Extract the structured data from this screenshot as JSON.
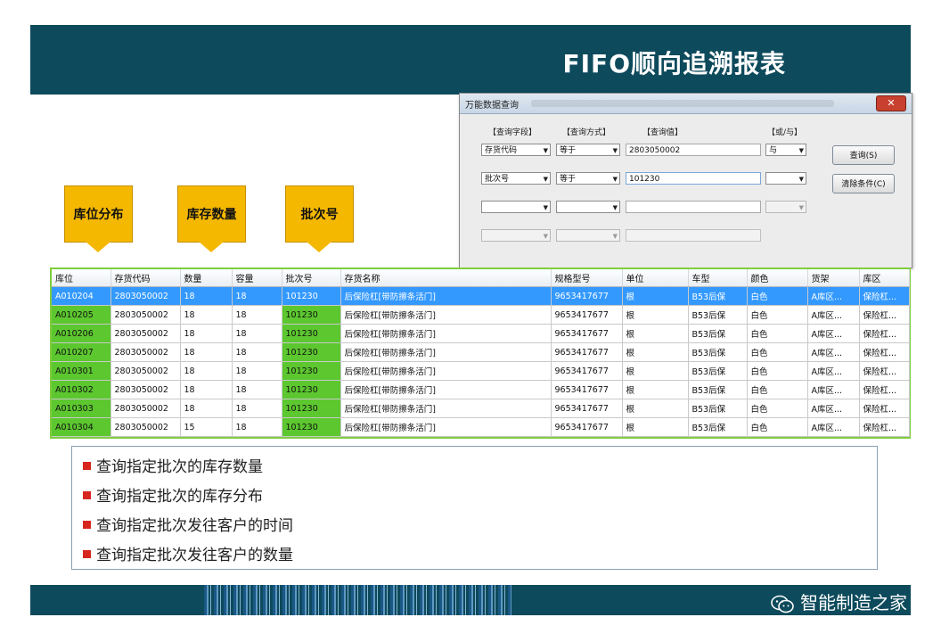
{
  "slide": {
    "title": "FIFO顺向追溯报表"
  },
  "dialog": {
    "title": "万能数据查询",
    "close_label": "✕",
    "headers": {
      "field": "【查询字段】",
      "method": "【查询方式】",
      "value": "【查询值】",
      "andor": "【或/与】"
    },
    "rows": [
      {
        "field": "存货代码",
        "method": "等于",
        "value": "2803050002",
        "andor": "与"
      },
      {
        "field": "批次号",
        "method": "等于",
        "value": "101230",
        "andor": ""
      },
      {
        "field": "",
        "method": "",
        "value": "",
        "andor": ""
      },
      {
        "field": "",
        "method": "",
        "value": "",
        "andor": ""
      }
    ],
    "query_button": "查询(S)",
    "clear_button": "清除条件(C)"
  },
  "callouts": [
    "库位分布",
    "库存数量",
    "批次号"
  ],
  "table": {
    "columns": [
      "库位",
      "存货代码",
      "数量",
      "容量",
      "批次号",
      "存货名称",
      "规格型号",
      "单位",
      "车型",
      "颜色",
      "货架",
      "库区"
    ],
    "rows": [
      [
        "A010204",
        "2803050002",
        "18",
        "18",
        "101230",
        "后保险杠[带防擦条活门]",
        "9653417677",
        "根",
        "B53后保",
        "白色",
        "A库区...",
        "保险杠..."
      ],
      [
        "A010205",
        "2803050002",
        "18",
        "18",
        "101230",
        "后保险杠[带防擦条活门]",
        "9653417677",
        "根",
        "B53后保",
        "白色",
        "A库区...",
        "保险杠..."
      ],
      [
        "A010206",
        "2803050002",
        "18",
        "18",
        "101230",
        "后保险杠[带防擦条活门]",
        "9653417677",
        "根",
        "B53后保",
        "白色",
        "A库区...",
        "保险杠..."
      ],
      [
        "A010207",
        "2803050002",
        "18",
        "18",
        "101230",
        "后保险杠[带防擦条活门]",
        "9653417677",
        "根",
        "B53后保",
        "白色",
        "A库区...",
        "保险杠..."
      ],
      [
        "A010301",
        "2803050002",
        "18",
        "18",
        "101230",
        "后保险杠[带防擦条活门]",
        "9653417677",
        "根",
        "B53后保",
        "白色",
        "A库区...",
        "保险杠..."
      ],
      [
        "A010302",
        "2803050002",
        "18",
        "18",
        "101230",
        "后保险杠[带防擦条活门]",
        "9653417677",
        "根",
        "B53后保",
        "白色",
        "A库区...",
        "保险杠..."
      ],
      [
        "A010303",
        "2803050002",
        "18",
        "18",
        "101230",
        "后保险杠[带防擦条活门]",
        "9653417677",
        "根",
        "B53后保",
        "白色",
        "A库区...",
        "保险杠..."
      ],
      [
        "A010304",
        "2803050002",
        "15",
        "18",
        "101230",
        "后保险杠[带防擦条活门]",
        "9653417677",
        "根",
        "B53后保",
        "白色",
        "A库区...",
        "保险杠..."
      ]
    ],
    "selected_row": 0
  },
  "bullets": [
    "查询指定批次的库存数量",
    "查询指定批次的库存分布",
    "查询指定批次发往客户的时间",
    "查询指定批次发往客户的数量"
  ],
  "footer": {
    "brand": "智能制造之家"
  },
  "colors": {
    "banner": "#0d4a5c",
    "callout": "#f5b800",
    "highlight_column": "#5cc72f",
    "selected_row": "#3399ff",
    "bullet": "#d7261e"
  }
}
